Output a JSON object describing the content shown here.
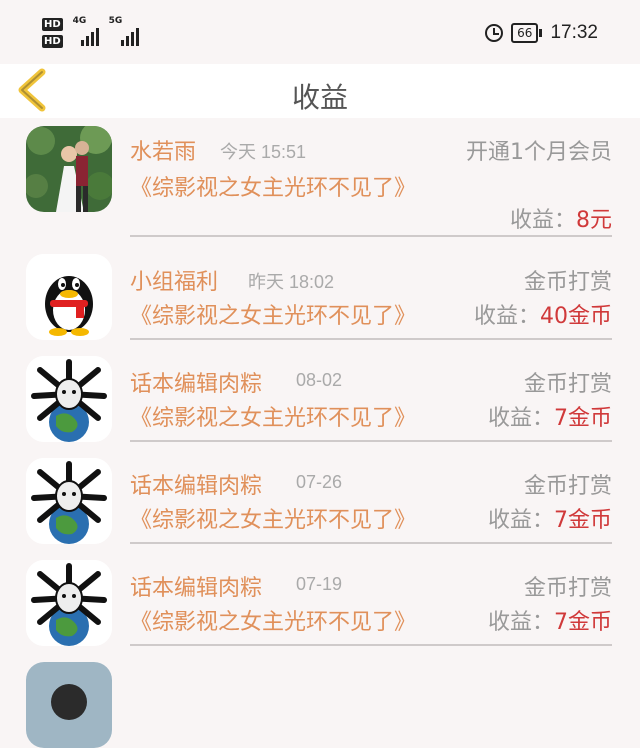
{
  "status_bar": {
    "hd1": "HD",
    "hd2": "HD",
    "net1": "4G",
    "net2": "5G",
    "battery": "66",
    "time": "17:32"
  },
  "header": {
    "title": "收益"
  },
  "rows": [
    {
      "name": "水若雨",
      "time": "今天 15:51",
      "type": "开通1个月会员",
      "book": "《综影视之女主光环不见了》",
      "earn_label": "收益：",
      "earn_value": "8元"
    },
    {
      "name": "小组福利",
      "time": "昨天 18:02",
      "type": "金币打赏",
      "book": "《综影视之女主光环不见了》",
      "earn_label": "收益：",
      "earn_value": "40金币"
    },
    {
      "name": "话本编辑肉粽",
      "time": "08-02",
      "type": "金币打赏",
      "book": "《综影视之女主光环不见了》",
      "earn_label": "收益：",
      "earn_value": "7金币"
    },
    {
      "name": "话本编辑肉粽",
      "time": "07-26",
      "type": "金币打赏",
      "book": "《综影视之女主光环不见了》",
      "earn_label": "收益：",
      "earn_value": "7金币"
    },
    {
      "name": "话本编辑肉粽",
      "time": "07-19",
      "type": "金币打赏",
      "book": "《综影视之女主光环不见了》",
      "earn_label": "收益：",
      "earn_value": "7金币"
    }
  ],
  "colors": {
    "accent": "#e0905a",
    "amount": "#d0393a",
    "back_arrow": "#f0c43a"
  },
  "icons": [
    "alarm-icon",
    "battery-icon",
    "back-arrow-icon",
    "signal-icon"
  ]
}
